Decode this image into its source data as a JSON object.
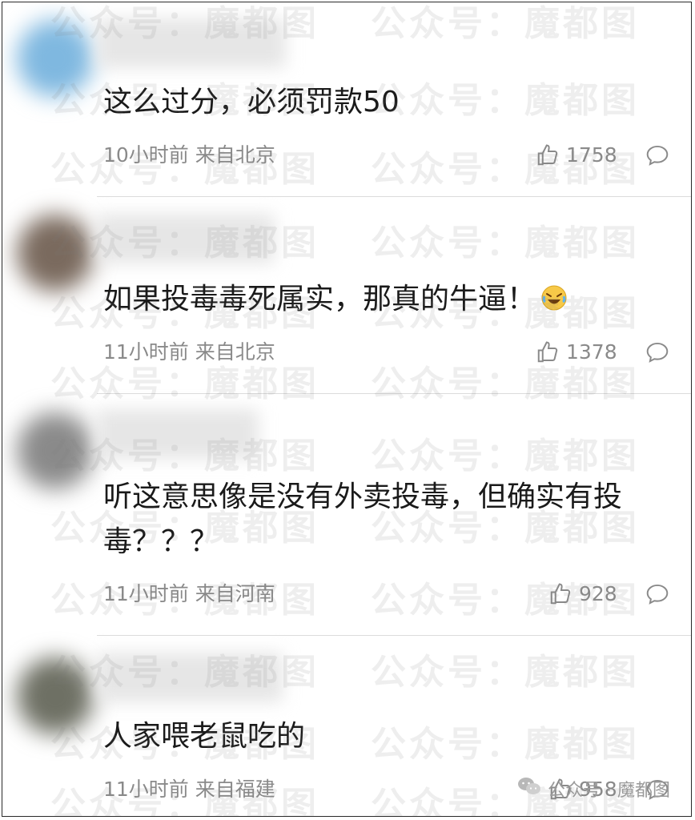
{
  "watermark": "公众号：魔都图",
  "comments": [
    {
      "text": "这么过分，必须罚款50",
      "time": "10小时前",
      "location": "来自北京",
      "likes": "1758",
      "avatar_color": "#7fb8e0"
    },
    {
      "text": "如果投毒毒死属实，那真的牛逼！",
      "time": "11小时前",
      "location": "来自北京",
      "likes": "1378",
      "avatar_color": "#7a6a5e",
      "emoji": "laughing-crying-emoji"
    },
    {
      "text": "听这意思像是没有外卖投毒，但确实有投毒？？？",
      "time": "11小时前",
      "location": "来自河南",
      "likes": "928",
      "avatar_color": "#8a8a8a"
    },
    {
      "text": "人家喂老鼠吃的",
      "time": "11小时前",
      "location": "来自福建",
      "likes": "958",
      "avatar_color": "#6e7064"
    }
  ],
  "icons": {
    "like": "thumbs-up-icon",
    "reply": "comment-bubble-icon"
  },
  "corner_label": "公众号 · 魔都图"
}
